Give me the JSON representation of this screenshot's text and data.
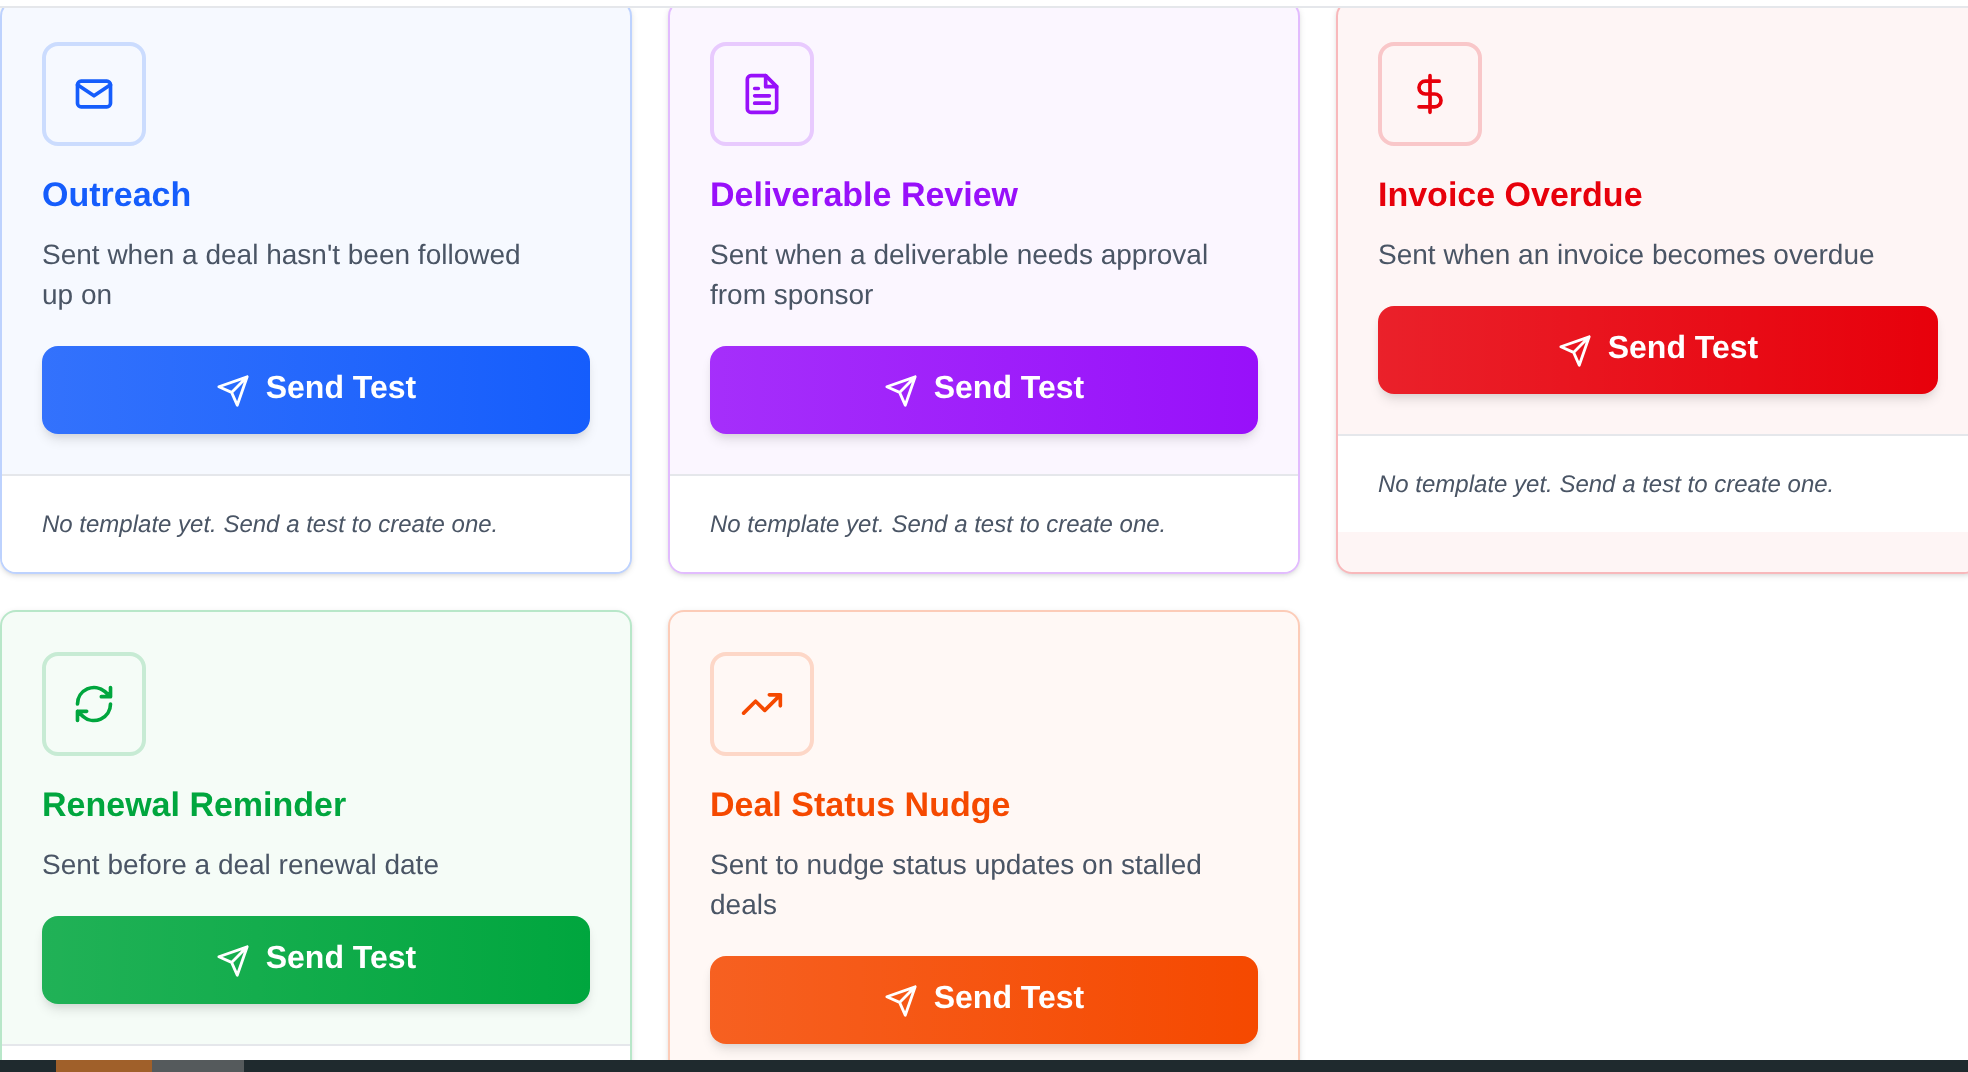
{
  "cards": [
    {
      "title": "Outreach",
      "description": "Sent when a deal hasn't been followed up on",
      "button": "Send Test",
      "footer": "No template yet. Send a test to create one.",
      "color": "#155dfc"
    },
    {
      "title": "Deliverable Review",
      "description": "Sent when a deliverable needs approval from sponsor",
      "button": "Send Test",
      "footer": "No template yet. Send a test to create one.",
      "color": "#9810fa"
    },
    {
      "title": "Invoice Overdue",
      "description": "Sent when an invoice becomes overdue",
      "button": "Send Test",
      "footer": "No template yet. Send a test to create one.",
      "color": "#e7000b"
    },
    {
      "title": "Renewal Reminder",
      "description": "Sent before a deal renewal date",
      "button": "Send Test",
      "color": "#00a63e"
    },
    {
      "title": "Deal Status Nudge",
      "description": "Sent to nudge status updates on stalled deals",
      "button": "Send Test",
      "color": "#f54900"
    }
  ]
}
